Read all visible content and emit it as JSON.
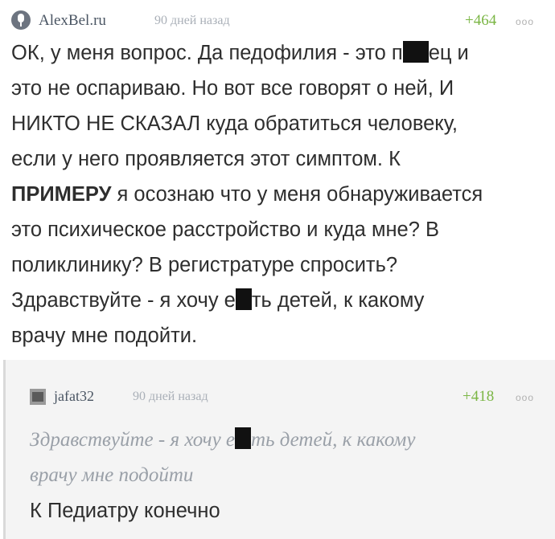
{
  "comment": {
    "author": "AlexBel.ru",
    "time": "90 дней назад",
    "rating": "+464",
    "more": "ooo",
    "lines": {
      "l1a": "ОК, у меня вопрос. Да педофилия - это п",
      "l1b": "ец и",
      "l2": "это не оспариваю. Но вот все говорят о ней, И",
      "l3": "НИКТО НЕ СКАЗАЛ куда обратиться человеку,",
      "l4": "если у него проявляется этот симптом. К",
      "l5bold": "ПРИМЕРУ",
      "l5": " я осознаю что у меня обнаруживается",
      "l6": "это психическое расстройство и куда мне? В",
      "l7": "поликлинику? В регистратуре спросить?",
      "l8a": "Здравствуйте - я хочу е",
      "l8b": "ть детей, к какому",
      "l9": "врачу мне подойти."
    }
  },
  "reply": {
    "author": "jafat32",
    "time": "90 дней назад",
    "rating": "+418",
    "more": "ooo",
    "quote": {
      "q1a": "Здравствуйте - я хочу е",
      "q1b": "ть детей, к какому",
      "q2": "врачу мне подойти"
    },
    "text": "К Педиатру конечно"
  },
  "colors": {
    "rating_green": "#7bb645",
    "meta_gray": "#aab0b8",
    "quote_gray": "#9aa0a8",
    "reply_bg": "#f4f4f4"
  }
}
